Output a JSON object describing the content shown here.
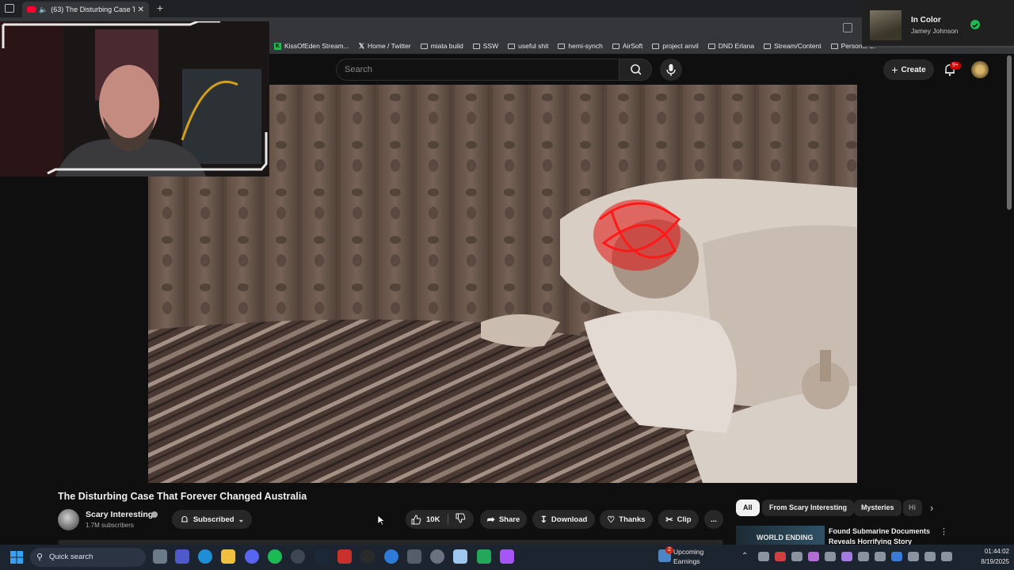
{
  "browser": {
    "tab_title": "(63) The Disturbing Case Th...",
    "new_tab": "+",
    "bookmarks": [
      {
        "label": "KissOfEden Stream...",
        "icon": "kiss-of-eden-icon"
      },
      {
        "label": "Home / Twitter",
        "icon": "x-twitter-icon"
      },
      {
        "label": "miata build",
        "icon": "folder-icon"
      },
      {
        "label": "SSW",
        "icon": "folder-icon"
      },
      {
        "label": "useful shit",
        "icon": "folder-icon"
      },
      {
        "label": "hemi-synch",
        "icon": "folder-icon"
      },
      {
        "label": "AirSoft",
        "icon": "folder-icon"
      },
      {
        "label": "project anvil",
        "icon": "folder-icon"
      },
      {
        "label": "DND Erlana",
        "icon": "folder-icon"
      },
      {
        "label": "Stream/Content",
        "icon": "folder-icon"
      },
      {
        "label": "Personal Di",
        "icon": "folder-icon"
      }
    ]
  },
  "header": {
    "search_placeholder": "Search",
    "create_label": "Create",
    "notifications_badge": "9+"
  },
  "now_playing": {
    "title": "In Color",
    "artist": "Jamey Johnson"
  },
  "video": {
    "title": "The Disturbing Case That Forever Changed Australia",
    "channel": "Scary Interesting",
    "subscribers": "1.7M subscribers",
    "subscribed_label": "Subscribed",
    "like_count": "10K",
    "share_label": "Share",
    "download_label": "Download",
    "thanks_label": "Thanks",
    "clip_label": "Clip",
    "more_label": "..."
  },
  "sidebar": {
    "chips": [
      "All",
      "From Scary Interesting",
      "Mysteries",
      "Hi"
    ],
    "recommended": {
      "thumb_text": "WORLD ENDING",
      "title": "Found Submarine Documents Reveals Horrifying Story"
    }
  },
  "taskbar": {
    "search_label": "Quick search",
    "widget_badge": "2",
    "widget_line1": "Upcoming",
    "widget_line2": "Earnings",
    "time": "01:44:02",
    "date": "8/19/2025"
  },
  "colors": {
    "background": "#0f0f0f",
    "youtube_red": "#ff0033",
    "spotify_green": "#1db954",
    "chip_active": "#f1f1f1",
    "taskbar": "#1c2430"
  }
}
